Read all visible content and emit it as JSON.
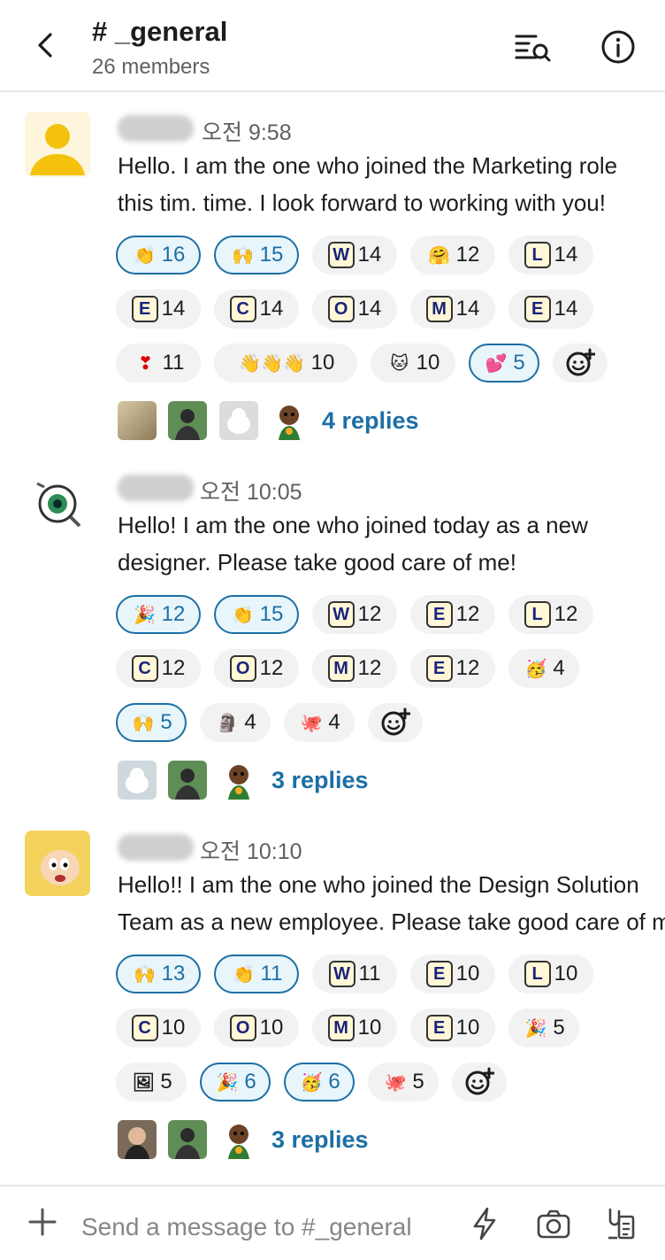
{
  "header": {
    "channel": "# _general",
    "members": "26 members"
  },
  "messages": [
    {
      "time": "오전 9:58",
      "lines": [
        "Hello. I am the one who joined the Marketing role",
        "this tim. time. I look forward to working with you!"
      ],
      "reactions": [
        {
          "icon": "clapping-hands-icon",
          "glyph": "👏",
          "count": "16",
          "selected": true
        },
        {
          "icon": "raised-hands-icon",
          "glyph": "🙌",
          "count": "15",
          "selected": true
        },
        {
          "icon": "letter-w-icon",
          "glyph": "W",
          "count": "14",
          "selected": false
        },
        {
          "icon": "hugging-face-icon",
          "glyph": "🤗",
          "count": "12",
          "selected": false
        },
        {
          "icon": "letter-l-icon",
          "glyph": "L",
          "count": "14",
          "selected": false
        },
        {
          "icon": "letter-e-icon",
          "glyph": "E",
          "count": "14",
          "selected": false
        },
        {
          "icon": "letter-c-icon",
          "glyph": "C",
          "count": "14",
          "selected": false
        },
        {
          "icon": "letter-o-icon",
          "glyph": "O",
          "count": "14",
          "selected": false
        },
        {
          "icon": "letter-m-icon",
          "glyph": "M",
          "count": "14",
          "selected": false
        },
        {
          "icon": "letter-e-icon",
          "glyph": "E",
          "count": "14",
          "selected": false
        },
        {
          "icon": "heart-exclamation-icon",
          "glyph": "❣",
          "count": "11",
          "selected": false
        },
        {
          "icon": "waving-hands-icon",
          "glyph": "👋👋👋",
          "count": "10",
          "selected": false
        },
        {
          "icon": "green-cat-icon",
          "glyph": "🐱",
          "count": "10",
          "selected": false
        },
        {
          "icon": "pink-heart-icon",
          "glyph": "💕",
          "count": "5",
          "selected": true
        }
      ],
      "replies": "4 replies"
    },
    {
      "time": "오전 10:05",
      "lines": [
        "Hello! I am the one who joined today as a new",
        "designer. Please take good care of me!"
      ],
      "reactions": [
        {
          "icon": "party-face-icon",
          "glyph": "🎉",
          "count": "12",
          "selected": true
        },
        {
          "icon": "clapping-hands-icon",
          "glyph": "👏",
          "count": "15",
          "selected": true
        },
        {
          "icon": "letter-w-icon",
          "glyph": "W",
          "count": "12",
          "selected": false
        },
        {
          "icon": "letter-e-icon",
          "glyph": "E",
          "count": "12",
          "selected": false
        },
        {
          "icon": "letter-l-icon",
          "glyph": "L",
          "count": "12",
          "selected": false
        },
        {
          "icon": "letter-c-icon",
          "glyph": "C",
          "count": "12",
          "selected": false
        },
        {
          "icon": "letter-o-icon",
          "glyph": "O",
          "count": "12",
          "selected": false
        },
        {
          "icon": "letter-m-icon",
          "glyph": "M",
          "count": "12",
          "selected": false
        },
        {
          "icon": "letter-e-icon",
          "glyph": "E",
          "count": "12",
          "selected": false
        },
        {
          "icon": "partying-face-icon",
          "glyph": "🥳",
          "count": "4",
          "selected": false
        },
        {
          "icon": "raised-hands-icon",
          "glyph": "🙌",
          "count": "5",
          "selected": true
        },
        {
          "icon": "custom-figure-icon",
          "glyph": "🗿",
          "count": "4",
          "selected": false
        },
        {
          "icon": "octopus-icon",
          "glyph": "🐙",
          "count": "4",
          "selected": false
        }
      ],
      "replies": "3 replies"
    },
    {
      "time": "오전 10:10",
      "lines": [
        "Hello!! I am the one who joined the Design Solution",
        "Team as a new employee. Please take good care of me :)"
      ],
      "reactions": [
        {
          "icon": "raised-hands-icon",
          "glyph": "🙌",
          "count": "13",
          "selected": true
        },
        {
          "icon": "clapping-hands-icon",
          "glyph": "👏",
          "count": "11",
          "selected": true
        },
        {
          "icon": "letter-w-icon",
          "glyph": "W",
          "count": "11",
          "selected": false
        },
        {
          "icon": "letter-e-icon",
          "glyph": "E",
          "count": "10",
          "selected": false
        },
        {
          "icon": "letter-l-icon",
          "glyph": "L",
          "count": "10",
          "selected": false
        },
        {
          "icon": "letter-c-icon",
          "glyph": "C",
          "count": "10",
          "selected": false
        },
        {
          "icon": "letter-o-icon",
          "glyph": "O",
          "count": "10",
          "selected": false
        },
        {
          "icon": "letter-m-icon",
          "glyph": "M",
          "count": "10",
          "selected": false
        },
        {
          "icon": "letter-e-icon",
          "glyph": "E",
          "count": "10",
          "selected": false
        },
        {
          "icon": "party-face-icon",
          "glyph": "🎉",
          "count": "5",
          "selected": false
        },
        {
          "icon": "custom-photo-icon",
          "glyph": "🖼",
          "count": "5",
          "selected": false
        },
        {
          "icon": "party-popper-icon",
          "glyph": "🎉",
          "count": "6",
          "selected": true
        },
        {
          "icon": "partying-face-icon",
          "glyph": "🥳",
          "count": "6",
          "selected": true
        },
        {
          "icon": "octopus-icon",
          "glyph": "🐙",
          "count": "5",
          "selected": false
        }
      ],
      "replies": "3 replies"
    }
  ],
  "composer": {
    "placeholder": "Send a message to #_general"
  },
  "colors": {
    "link": "#1d6fa5",
    "selected_bg": "#e8f5fa",
    "pill_bg": "#f2f2f2"
  }
}
